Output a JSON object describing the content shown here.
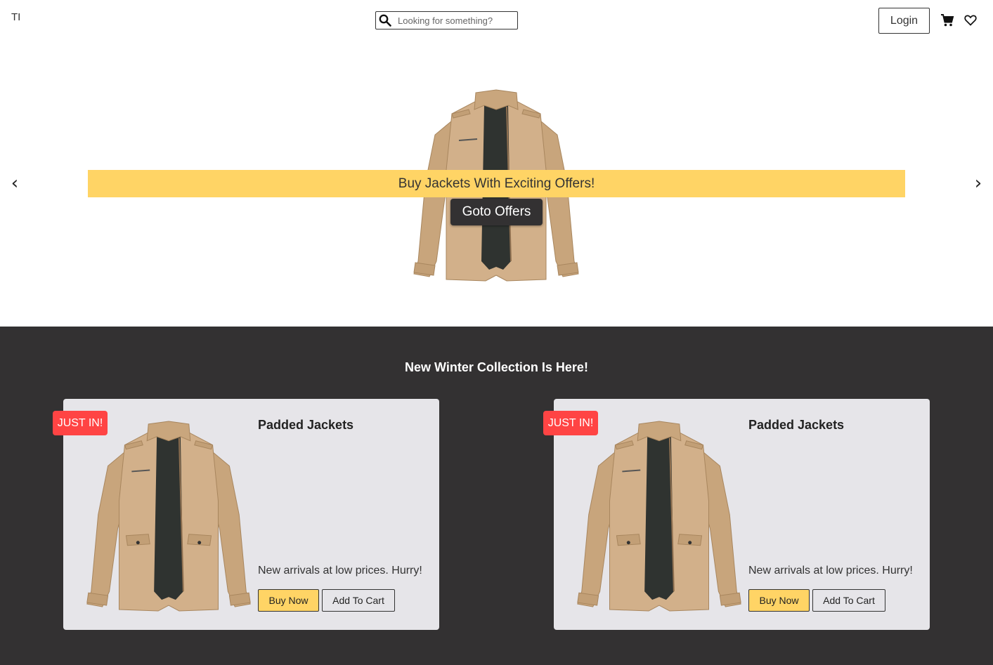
{
  "header": {
    "logo": "TI",
    "search": {
      "placeholder": "Looking for something?",
      "icon": "search-icon"
    },
    "login_label": "Login",
    "cart_icon": "cart-icon",
    "wishlist_icon": "heart-icon"
  },
  "hero": {
    "prev_arrow": "‹",
    "next_arrow": "›",
    "banner_text": "Buy Jackets With Exciting Offers!",
    "cta_label": "Goto Offers",
    "banner_color": "#ffd465",
    "cta_color": "#333132"
  },
  "collection": {
    "title": "New Winter Collection Is Here!",
    "background": "#333132",
    "cards": [
      {
        "badge": "JUST IN!",
        "title": "Padded Jackets",
        "description": "New arrivals at low prices. Hurry!",
        "buy_label": "Buy Now",
        "cart_label": "Add To Cart"
      },
      {
        "badge": "JUST IN!",
        "title": "Padded Jackets",
        "description": "New arrivals at low prices. Hurry!",
        "buy_label": "Buy Now",
        "cart_label": "Add To Cart"
      }
    ]
  },
  "colors": {
    "accent": "#ffd465",
    "badge": "#ff4444",
    "card_bg": "#e6e5e9"
  }
}
